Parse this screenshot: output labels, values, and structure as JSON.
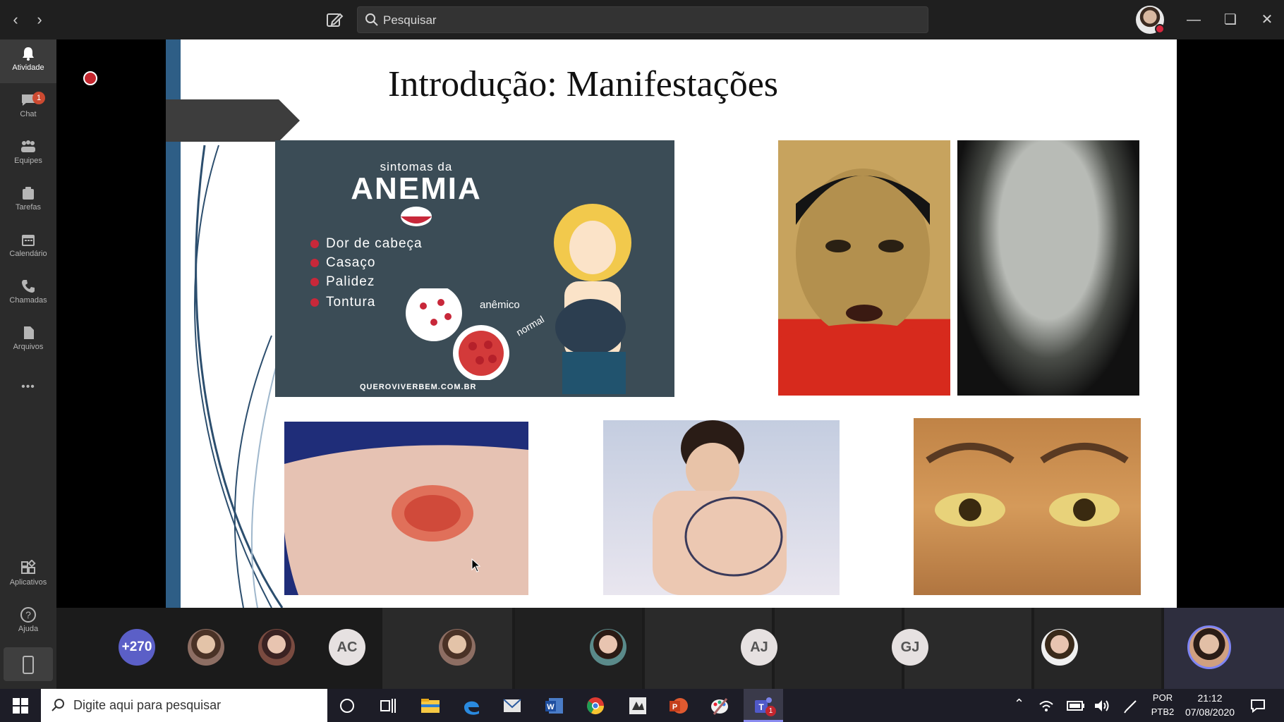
{
  "topbar": {
    "search_placeholder": "Pesquisar",
    "accent": "#d7263d"
  },
  "rail": {
    "items": [
      {
        "label": "Atividade",
        "icon": "bell-icon",
        "active": true
      },
      {
        "label": "Chat",
        "icon": "chat-icon",
        "badge": "1"
      },
      {
        "label": "Equipes",
        "icon": "teams-icon"
      },
      {
        "label": "Tarefas",
        "icon": "tasks-icon"
      },
      {
        "label": "Calendário",
        "icon": "calendar-icon"
      },
      {
        "label": "Chamadas",
        "icon": "phone-icon"
      },
      {
        "label": "Arquivos",
        "icon": "files-icon"
      }
    ],
    "more": "•••",
    "apps_label": "Aplicativos",
    "help_label": "Ajuda"
  },
  "slide": {
    "title": "Introdução: Manifestações",
    "anemia": {
      "kicker": "sintomas da",
      "title": "ANEMIA",
      "symptoms": [
        "Dor de cabeça",
        "Casaço",
        "Palidez",
        "Tontura"
      ],
      "label_anemic": "anêmico",
      "label_normal": "normal",
      "site": "QUEROVIVERBEM.COM.BR"
    }
  },
  "participants": {
    "overflow": "+270",
    "initials": [
      "AC",
      "AJ",
      "GJ"
    ]
  },
  "taskbar": {
    "search_placeholder": "Digite aqui para pesquisar",
    "lang_top": "POR",
    "lang_bottom": "PTB2",
    "time": "21:12",
    "date": "07/08/2020",
    "teams_badge": "1"
  }
}
